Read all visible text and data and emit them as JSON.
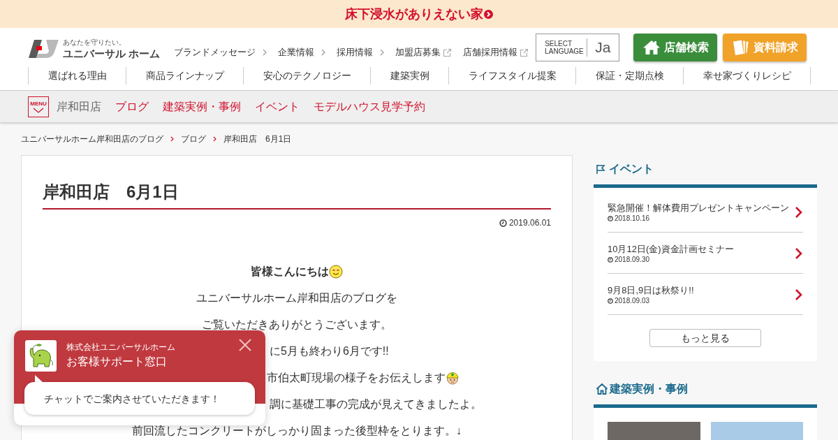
{
  "announcement": {
    "text": "床下浸水がありえない家"
  },
  "header": {
    "logo": {
      "tagline": "あなたを守りたい。",
      "name": "ユニバーサル ホーム"
    },
    "top_links": [
      {
        "label": "ブランドメッセージ",
        "kind": "internal"
      },
      {
        "label": "企業情報",
        "kind": "internal"
      },
      {
        "label": "採用情報",
        "kind": "internal"
      },
      {
        "label": "加盟店募集",
        "kind": "external"
      },
      {
        "label": "店舗採用情報",
        "kind": "external"
      }
    ],
    "language_selector": {
      "label": "SELECT LANGUAGE",
      "value": "Ja"
    },
    "buttons": [
      {
        "label": "店舗検索",
        "kind": "store"
      },
      {
        "label": "資料請求",
        "kind": "brochure"
      }
    ],
    "main_nav": [
      "選ばれる理由",
      "商品ラインナップ",
      "安心のテクノロジー",
      "建築実例",
      "ライフスタイル提案",
      "保証・定期点検",
      "幸せ家づくりレシピ"
    ]
  },
  "store_nav": {
    "menu_label": "MENU",
    "store_name": "岸和田店",
    "links": [
      "ブログ",
      "建築実例・事例",
      "イベント",
      "モデルハウス見学予約"
    ]
  },
  "breadcrumb": [
    "ユニバーサルホーム岸和田店のブログ",
    "ブログ",
    "岸和田店　6月1日"
  ],
  "article": {
    "title": "岸和田店　6月1日",
    "date": "2019.06.01",
    "lines": [
      {
        "text": "皆様こんにちは",
        "kind": "greeting"
      },
      {
        "text": "ユニバーサルホーム岸和田店のブログを",
        "kind": "plain"
      },
      {
        "text": "ご覧いただきありがとうございます。",
        "kind": "plain"
      },
      {
        "text": "に5月も終わり6月です!!",
        "kind": "clipped"
      },
      {
        "text": "市伯太町現場の様子をお伝えします",
        "kind": "report"
      },
      {
        "text": "調に基礎工事の完成が見えてきましたよ。",
        "kind": "clipped"
      },
      {
        "text": "前回流したコンクリートがしっかり固まった後型枠をとります。↓",
        "kind": "plain"
      }
    ]
  },
  "sidebar": {
    "events": {
      "title": "イベント",
      "items": [
        {
          "title": "緊急開催！解体費用プレゼントキャンペーン",
          "date": "2018.10.16"
        },
        {
          "title": "10月12日(金)資金計画セミナー",
          "date": "2018.09.30"
        },
        {
          "title": "9月8日,9日は秋祭り!!",
          "date": "2018.09.03"
        }
      ],
      "more_button": "もっと見る"
    },
    "works": {
      "title": "建築実例・事例"
    }
  },
  "chat": {
    "company": "株式会社ユニバーサルホーム",
    "title": "お客様サポート窓口",
    "message": "チャットでご案内させていただきます！"
  }
}
